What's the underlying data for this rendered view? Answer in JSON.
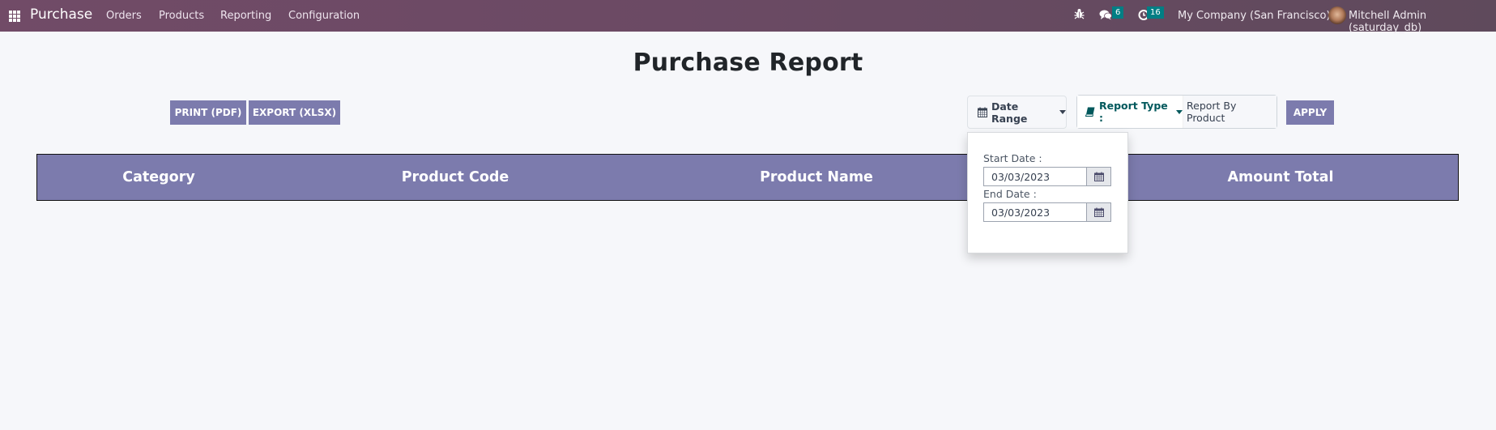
{
  "navbar": {
    "app_name": "Purchase",
    "menu": [
      "Orders",
      "Products",
      "Reporting",
      "Configuration"
    ],
    "icons": {
      "apps": "apps-grid-icon",
      "debug": "bug-icon",
      "messages": "chat-icon",
      "activities": "clock-icon"
    },
    "messages_count": "6",
    "activities_count": "16",
    "company": "My Company (San Francisco)",
    "user": "Mitchell Admin (saturday_db)"
  },
  "page": {
    "title": "Purchase Report"
  },
  "toolbar": {
    "print_label": "PRINT (PDF)",
    "export_label": "EXPORT (XLSX)",
    "date_range_label": "Date Range",
    "report_type_label": "Report Type :",
    "report_type_value": "Report By Product",
    "apply_label": "APPLY"
  },
  "date_dropdown": {
    "start_label": "Start Date :",
    "start_value": "03/03/2023",
    "end_label": "End Date :",
    "end_value": "03/03/2023"
  },
  "table": {
    "columns": [
      "Category",
      "Product Code",
      "Product Name",
      "Amount Total"
    ],
    "rows": []
  },
  "colors": {
    "navbar": "#714b67",
    "primary_button": "#7c7bad",
    "table_header": "#7c7bad",
    "badge": "#017e84",
    "report_type_text": "#01585c"
  }
}
